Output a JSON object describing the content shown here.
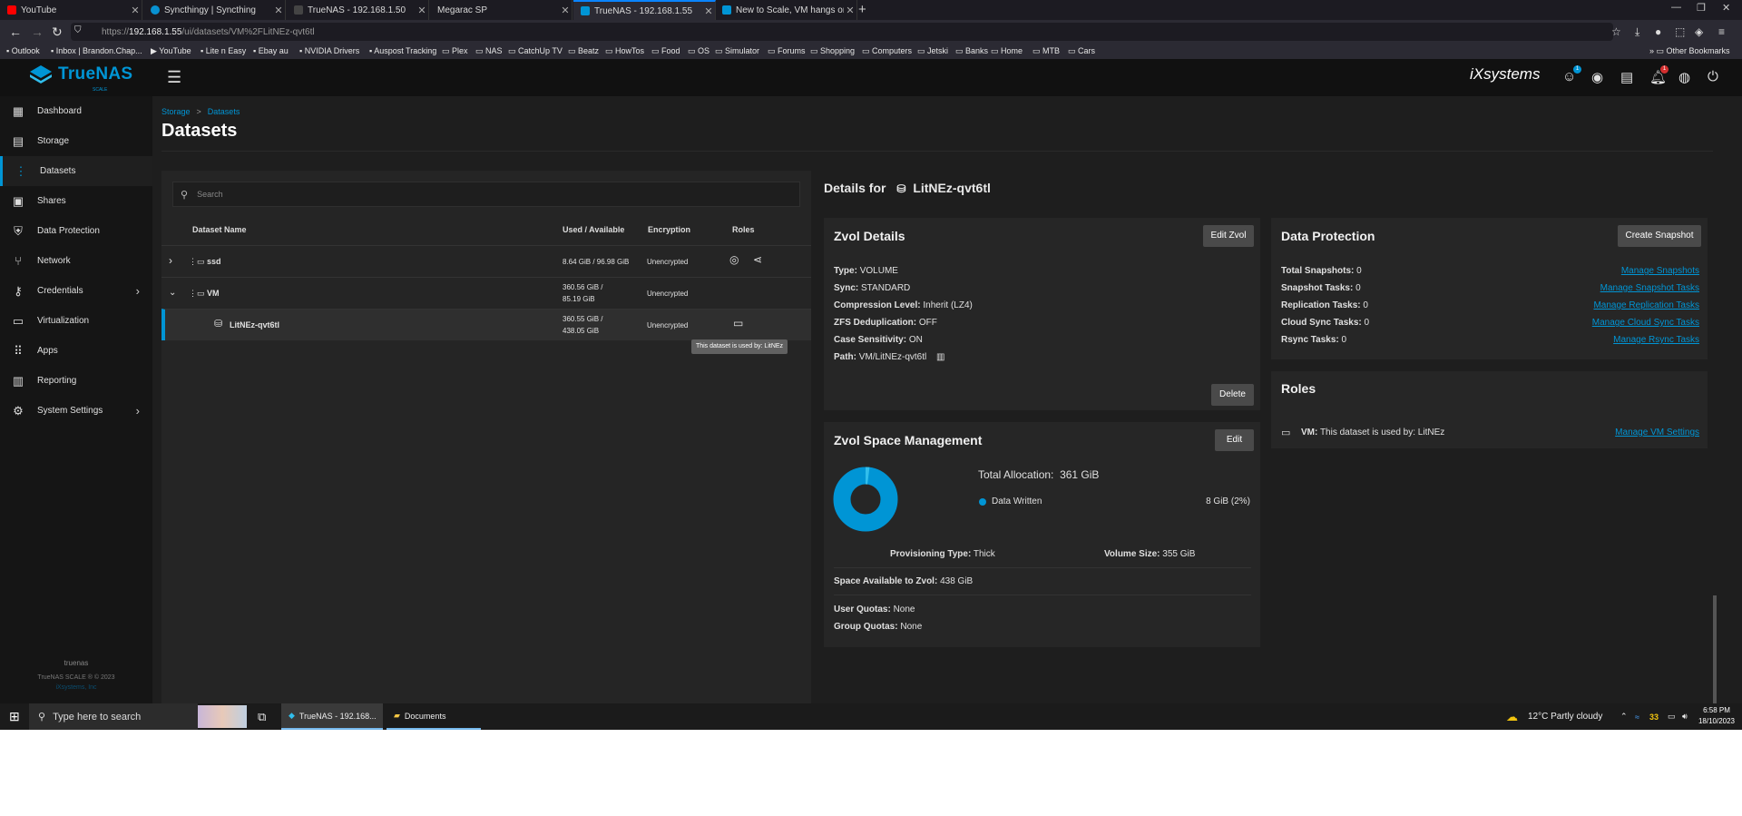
{
  "browser": {
    "tabs": [
      {
        "label": "YouTube",
        "color": "#ff0000"
      },
      {
        "label": "Syncthingy | Syncthing",
        "color": "#0891d1"
      },
      {
        "label": "TrueNAS - 192.168.1.50",
        "color": "#333333"
      },
      {
        "label": "Megarac SP",
        "color": "#1c1b22"
      },
      {
        "label": "TrueNAS - 192.168.1.55",
        "color": "#0095d5"
      },
      {
        "label": "New to Scale, VM hangs on boo",
        "color": "#0095d5"
      }
    ],
    "url_prefix": "https://",
    "url_host": "192.168.1.55",
    "url_path": "/ui/datasets/VM%2FLitNEz-qvt6tl",
    "bookmarks": [
      "Outlook",
      "Inbox | Brandon.Chap...",
      "YouTube",
      "Lite n Easy",
      "Ebay au",
      "NVIDIA Drivers",
      "Auspost Tracking",
      "Plex",
      "NAS",
      "CatchUp TV",
      "Beatz",
      "HowTos",
      "Food",
      "OS",
      "Simulator",
      "Forums",
      "Shopping",
      "Computers",
      "Jetski",
      "Banks",
      "Home",
      "MTB",
      "Cars"
    ],
    "other_bookmarks": "Other Bookmarks"
  },
  "header": {
    "logo": "TrueNAS",
    "logo_sub": "SCALE",
    "vendor": "iXsystems",
    "badge_tasks": "1",
    "badge_alerts": "1"
  },
  "sidebar": {
    "items": [
      {
        "label": "Dashboard",
        "icon": "dashboard-icon"
      },
      {
        "label": "Storage",
        "icon": "storage-icon"
      },
      {
        "label": "Datasets",
        "icon": "datasets-icon"
      },
      {
        "label": "Shares",
        "icon": "shares-icon"
      },
      {
        "label": "Data Protection",
        "icon": "shield-icon"
      },
      {
        "label": "Network",
        "icon": "network-icon"
      },
      {
        "label": "Credentials",
        "icon": "key-icon"
      },
      {
        "label": "Virtualization",
        "icon": "laptop-icon"
      },
      {
        "label": "Apps",
        "icon": "apps-icon"
      },
      {
        "label": "Reporting",
        "icon": "chart-icon"
      },
      {
        "label": "System Settings",
        "icon": "gear-icon"
      }
    ],
    "hostname": "truenas",
    "copyright": "TrueNAS SCALE ® © 2023",
    "company": "iXsystems, Inc"
  },
  "breadcrumb": {
    "parent": "Storage",
    "current": "Datasets"
  },
  "page_title": "Datasets",
  "table": {
    "search_placeholder": "Search",
    "headers": {
      "name": "Dataset Name",
      "used": "Used / Available",
      "encryption": "Encryption",
      "roles": "Roles"
    },
    "rows": [
      {
        "name": "ssd",
        "used": "8.64 GiB / 96.98 GiB",
        "encryption": "Unencrypted"
      },
      {
        "name": "VM",
        "used1": "360.56 GiB /",
        "used2": "85.19 GiB",
        "encryption": "Unencrypted"
      },
      {
        "name": "LitNEz-qvt6tl",
        "used1": "360.55 GiB /",
        "used2": "438.05 GiB",
        "encryption": "Unencrypted"
      }
    ],
    "tooltip": "This dataset is used by: LitNEz"
  },
  "details": {
    "label": "Details for",
    "name": "LitNEz-qvt6tl"
  },
  "zvol_details": {
    "title": "Zvol Details",
    "edit_label": "Edit Zvol",
    "delete_label": "Delete",
    "fields": [
      {
        "k": "Type:",
        "v": "VOLUME"
      },
      {
        "k": "Sync:",
        "v": "STANDARD"
      },
      {
        "k": "Compression Level:",
        "v": "Inherit (LZ4)"
      },
      {
        "k": "ZFS Deduplication:",
        "v": "OFF"
      },
      {
        "k": "Case Sensitivity:",
        "v": "ON"
      },
      {
        "k": "Path:",
        "v": "VM/LitNEz-qvt6tl"
      }
    ]
  },
  "space": {
    "title": "Zvol Space Management",
    "edit_label": "Edit",
    "total_label": "Total Allocation:",
    "total_value": "361 GiB",
    "legend_label": "Data Written",
    "legend_value": "8 GiB (2%)",
    "written_fraction": 0.02,
    "accent": "#0095d5",
    "prov_label": "Provisioning Type:",
    "prov_value": "Thick",
    "vol_label": "Volume Size:",
    "vol_value": "355 GiB",
    "avail_label": "Space Available to Zvol:",
    "avail_value": "438 GiB",
    "uq_label": "User Quotas:",
    "uq_value": "None",
    "gq_label": "Group Quotas:",
    "gq_value": "None"
  },
  "protection": {
    "title": "Data Protection",
    "create_label": "Create Snapshot",
    "rows": [
      {
        "k": "Total Snapshots:",
        "v": "0",
        "link": "Manage Snapshots"
      },
      {
        "k": "Snapshot Tasks:",
        "v": "0",
        "link": "Manage Snapshot Tasks"
      },
      {
        "k": "Replication Tasks:",
        "v": "0",
        "link": "Manage Replication Tasks"
      },
      {
        "k": "Cloud Sync Tasks:",
        "v": "0",
        "link": "Manage Cloud Sync Tasks"
      },
      {
        "k": "Rsync Tasks:",
        "v": "0",
        "link": "Manage Rsync Tasks"
      }
    ]
  },
  "roles": {
    "title": "Roles",
    "vm_label": "VM:",
    "vm_text": "This dataset is used by: LitNEz",
    "link": "Manage VM Settings"
  },
  "taskbar": {
    "search_placeholder": "Type here to search",
    "apps": [
      "TrueNAS - 192.168...",
      "Documents"
    ],
    "weather": "12°C  Partly cloudy",
    "temp_badge": "33",
    "time": "6:58 PM",
    "date": "18/10/2023"
  }
}
